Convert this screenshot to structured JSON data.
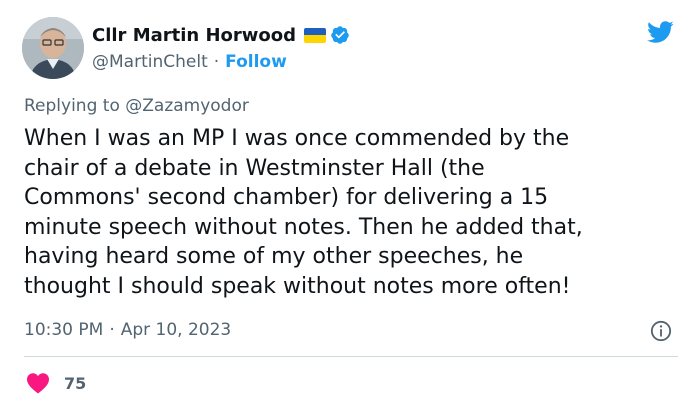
{
  "author": {
    "display_name": "Cllr Martin Horwood",
    "handle": "@MartinChelt",
    "separator": "·",
    "follow_label": "Follow",
    "flag_emoji": "ukraine-flag",
    "verified": true
  },
  "reply": {
    "prefix": "Replying to",
    "mention": "@Zazamyodor"
  },
  "tweet_text": "When I was an MP I was once commended by the\nchair of a debate in Westminster Hall (the\nCommons' second chamber) for delivering a 15\nminute speech without notes. Then he added that,\nhaving heard some of my other speeches, he\nthought I should speak without notes more often!",
  "meta": {
    "time": "10:30 PM",
    "separator": "·",
    "date": "Apr 10, 2023"
  },
  "engagement": {
    "likes": "75"
  },
  "colors": {
    "accent": "#1d9bf0",
    "heart": "#f91880",
    "muted": "#536471",
    "flag_blue": "#1f5fbf",
    "flag_yellow": "#ffd500"
  },
  "icons": {
    "brand": "twitter-bird-icon",
    "verified": "verified-badge-icon",
    "info": "info-icon",
    "like": "heart-icon"
  }
}
